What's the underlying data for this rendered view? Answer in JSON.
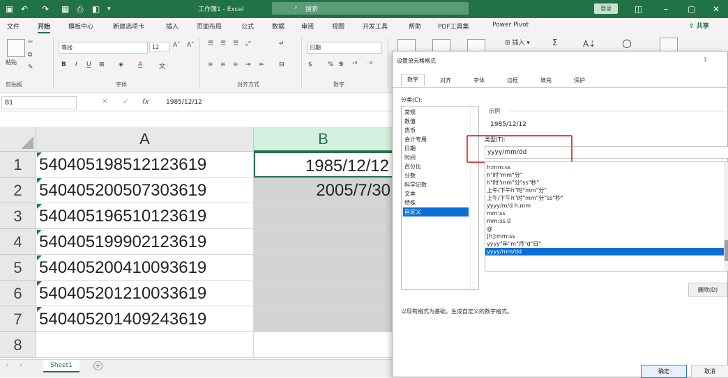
{
  "titlebar": {
    "title": "工作簿1 - Excel",
    "search_icon": "search-icon",
    "search_placeholder": "搜索",
    "login_label": "登录",
    "window_controls": [
      "ribbon-display-icon",
      "minimize-icon",
      "maximize-icon",
      "close-icon"
    ],
    "quick_access": [
      "save-icon",
      "undo-icon",
      "redo-icon",
      "table-icon",
      "print-icon",
      "preview-icon",
      "dropdown-icon"
    ]
  },
  "menu": {
    "items": [
      "文件",
      "开始",
      "模板中心",
      "新建选项卡",
      "插入",
      "页面布局",
      "公式",
      "数据",
      "审阅",
      "视图",
      "开发工具",
      "帮助",
      "PDF工具集",
      "Power Pivot"
    ],
    "active": "开始",
    "share_label": "共享"
  },
  "ribbon": {
    "clipboard_label": "剪贴板",
    "paste_label": "粘贴",
    "font_label": "字体",
    "font_name": "等线",
    "font_size": "12",
    "bold": "B",
    "italic": "I",
    "underline": "U",
    "align_label": "对齐方式",
    "number_label": "数字",
    "number_format": "日期",
    "percent": "%",
    "comma": "9",
    "insert_label": "插入",
    "sum_symbol": "Σ"
  },
  "formula_bar": {
    "name_box": "B1",
    "fx": "fx",
    "value": "1985/12/12"
  },
  "sheet": {
    "columns": [
      "A",
      "B"
    ],
    "rows": [
      {
        "num": "1",
        "a": "540405198512123619",
        "b": "1985/12/12"
      },
      {
        "num": "2",
        "a": "540405200507303619",
        "b": "2005/7/30"
      },
      {
        "num": "3",
        "a": "540405196510123619",
        "b": ""
      },
      {
        "num": "4",
        "a": "540405199902123619",
        "b": ""
      },
      {
        "num": "5",
        "a": "540405200410093619",
        "b": ""
      },
      {
        "num": "6",
        "a": "540405201210033619",
        "b": ""
      },
      {
        "num": "7",
        "a": "540405201409243619",
        "b": ""
      },
      {
        "num": "8",
        "a": "",
        "b": ""
      }
    ],
    "tab_name": "Sheet1",
    "add_sheet": "+"
  },
  "dialog": {
    "title": "设置单元格格式",
    "help": "?",
    "tabs": [
      "数字",
      "对齐",
      "字体",
      "边框",
      "填充",
      "保护"
    ],
    "active_tab": "数字",
    "category_label": "分类(C):",
    "categories": [
      "常规",
      "数值",
      "货币",
      "会计专用",
      "日期",
      "时间",
      "百分比",
      "分数",
      "科学记数",
      "文本",
      "特殊",
      "自定义"
    ],
    "selected_category": "自定义",
    "sample_label": "示例",
    "sample_value": "1985/12/12",
    "type_label": "类型(T):",
    "type_value": "yyyy/mm/dd",
    "formats": [
      "h:mm:ss",
      "h\"时\"mm\"分\"",
      "h\"时\"mm\"分\"ss\"秒\"",
      "上午/下午h\"时\"mm\"分\"",
      "上午/下午h\"时\"mm\"分\"ss\"秒\"",
      "yyyy/m/d h:mm",
      "mm:ss",
      "mm:ss.0",
      "@",
      "[h]:mm:ss",
      "yyyy\"年\"m\"月\"d\"日\"",
      "yyyy/mm/dd"
    ],
    "selected_format": "yyyy/mm/dd",
    "delete_label": "删除(D)",
    "description": "以现有格式为基础，生成自定义的数字格式。",
    "ok_label": "确定",
    "cancel_label": "取消"
  },
  "colors": {
    "excel_green": "#217346",
    "selection_blue": "#0b6fd6",
    "highlight_red": "#e04545"
  }
}
